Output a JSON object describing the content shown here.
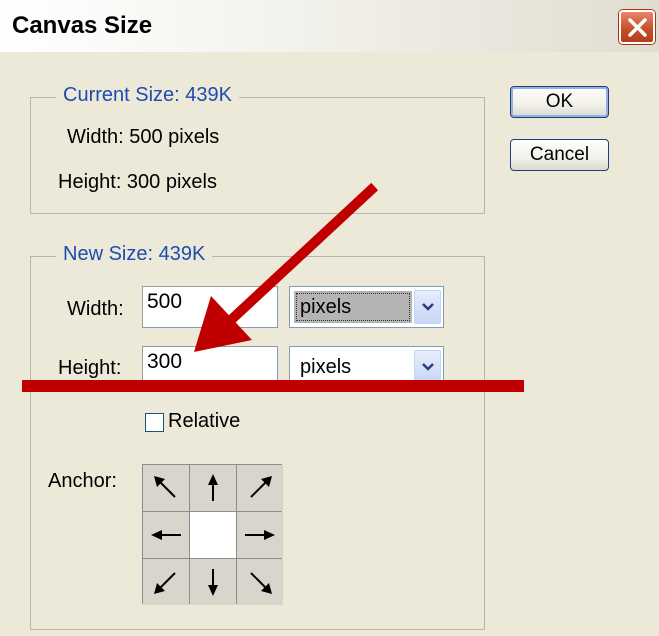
{
  "dialog": {
    "title": "Canvas Size",
    "close_icon": "close-x-icon"
  },
  "current_size": {
    "legend": "Current Size: 439K",
    "width_text": "Width: 500 pixels",
    "height_text": "Height: 300 pixels"
  },
  "buttons": {
    "ok": "OK",
    "cancel": "Cancel"
  },
  "new_size": {
    "legend": "New Size: 439K",
    "width_label": "Width:",
    "width_value": "500",
    "width_unit": "pixels",
    "height_label": "Height:",
    "height_value": "300",
    "height_unit": "pixels",
    "relative_label": "Relative",
    "relative_checked": false,
    "anchor_label": "Anchor:",
    "anchor_selected": "center"
  },
  "annotation": {
    "color": "#c00000",
    "icons": [
      "red-arrow-icon",
      "red-underline"
    ]
  },
  "colors": {
    "legend_text": "#1d4bb0",
    "dialog_bg": "#ece9d8",
    "close_button": "#c8502c"
  }
}
